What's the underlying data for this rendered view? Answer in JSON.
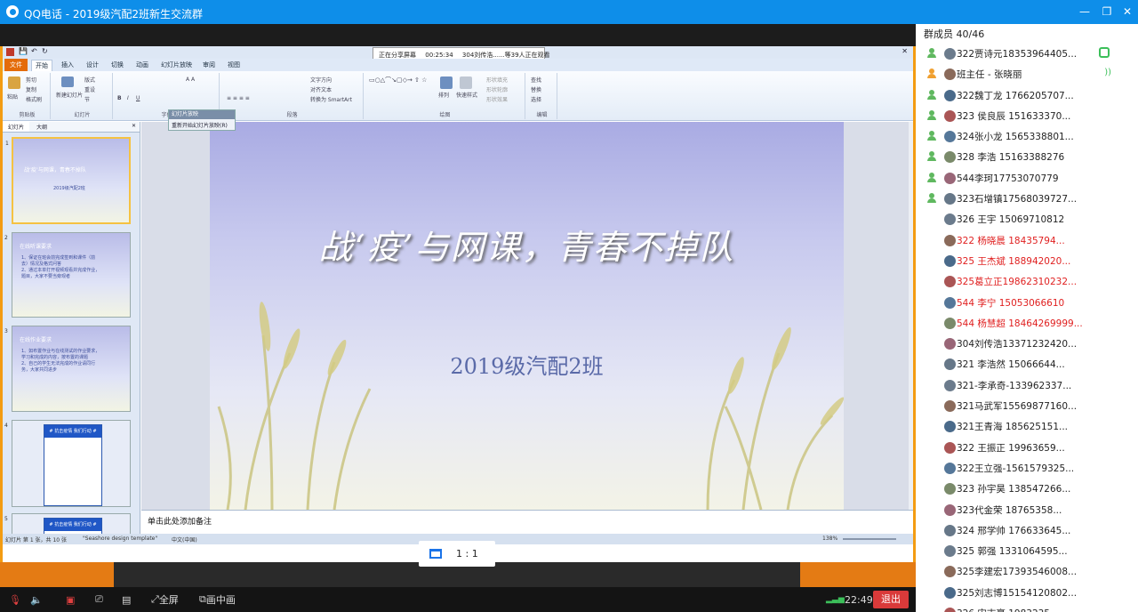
{
  "window": {
    "app_name": "QQ电话",
    "group_title": "2019级汽配2班新生交流群",
    "separator": " - "
  },
  "ppt": {
    "share_status": {
      "label": "正在分享屏幕",
      "time": "00:25:34",
      "viewers": "304刘传浩......等39人正在观看"
    },
    "tabs": [
      "文件",
      "开始",
      "插入",
      "设计",
      "切换",
      "动画",
      "幻灯片放映",
      "审阅",
      "视图"
    ],
    "active_tab": "开始",
    "ribbon": {
      "paste": "粘贴",
      "cut": "剪切",
      "copy": "复制",
      "format_painter": "格式刷",
      "new_slide": "新建幻灯片",
      "layout": "版式",
      "reset": "重设",
      "section": "节",
      "text_direction": "文字方向",
      "align_text": "对齐文本",
      "smartart": "转换为 SmartArt",
      "arrange": "排列",
      "quick_styles": "快速样式",
      "shape_fill": "形状填充",
      "shape_outline": "形状轮廓",
      "shape_effects": "形状效果",
      "find": "查找",
      "replace": "替换",
      "select": "选择",
      "group_clipboard": "剪贴板",
      "group_slides": "幻灯片",
      "group_font": "字体",
      "group_paragraph": "段落",
      "group_drawing": "绘图",
      "group_editing": "编辑"
    },
    "floating_toolbar": {
      "header": "幻灯片放映",
      "item": "重新开始幻灯片放映(R)"
    },
    "pane_tabs": [
      "幻灯片",
      "大纲"
    ],
    "thumbnails": [
      {
        "num": "1",
        "title": "战‘疫’与网课，青春不掉队",
        "sub": "2019级汽配2班"
      },
      {
        "num": "2",
        "title": "在线听课要求",
        "lines": [
          "1、保证在班会前完成签到和课件（前",
          "去）情况及格式问答",
          "2、通过本单打开视频观看并完成作业，",
          "题目，大家不要当旁观者"
        ]
      },
      {
        "num": "3",
        "title": "在线作业要求",
        "lines": [
          "1、如布置作业与在线测试的作业要求，",
          "学习和完成的内容，按布置的课题",
          "2、自己的学生无法完成的作业请同行",
          "务，大家共同进步"
        ]
      },
      {
        "num": "4",
        "title": "# 抗击疫情 我们行动 #"
      },
      {
        "num": "5",
        "title": "# 抗击疫情 我们行动 #"
      }
    ],
    "slide": {
      "title": "战‘疫’与网课，青春不掉队",
      "subtitle": "2019级汽配2班"
    },
    "notes_placeholder": "单击此处添加备注",
    "status": {
      "slide_info": "幻灯片 第 1 张，共 10 张",
      "theme": "\"Seashore design template\"",
      "language": "中文(中国)",
      "zoom": "138%"
    }
  },
  "ratio_label": "1 : 1",
  "bottom": {
    "fullscreen": "全屏",
    "pip": "画中画",
    "time": "22:49",
    "exit": "退出"
  },
  "members": {
    "header": "群成员 40/46",
    "list": [
      {
        "name": "322贾诗元18353964405...",
        "role": "admin",
        "red": false
      },
      {
        "name": "班主任 - 张晓丽",
        "role": "owner",
        "red": false
      },
      {
        "name": "322魏丁龙 1766205707...",
        "role": "admin",
        "red": false
      },
      {
        "name": "323 侯良辰 151633370...",
        "role": "admin",
        "red": false
      },
      {
        "name": "324张小龙 1565338801...",
        "role": "admin",
        "red": false
      },
      {
        "name": "328 李浩 15163388276",
        "role": "admin",
        "red": false
      },
      {
        "name": "544李珂17753070779",
        "role": "admin",
        "red": false
      },
      {
        "name": "323石增镇17568039727...",
        "role": "admin",
        "red": false
      },
      {
        "name": "326 王宇 15069710812",
        "role": "none",
        "red": false
      },
      {
        "name": "322   杨晓晨  18435794...",
        "role": "none",
        "red": true
      },
      {
        "name": "325  王杰斌 188942020...",
        "role": "none",
        "red": true
      },
      {
        "name": "325葛立正19862310232...",
        "role": "none",
        "red": true
      },
      {
        "name": "544 李宁 15053066610",
        "role": "none",
        "red": true
      },
      {
        "name": "544 杨慧超 18464269999...",
        "role": "none",
        "red": true
      },
      {
        "name": "304刘传浩13371232420...",
        "role": "none",
        "red": false
      },
      {
        "name": "321    李浩然  15066644...",
        "role": "none",
        "red": false
      },
      {
        "name": "321-李承奇-133962337...",
        "role": "none",
        "red": false
      },
      {
        "name": "321马武军15569877160...",
        "role": "none",
        "red": false
      },
      {
        "name": "321王青海    185625151...",
        "role": "none",
        "red": false
      },
      {
        "name": "322   王振正  19963659...",
        "role": "none",
        "red": false
      },
      {
        "name": "322王立强-1561579325...",
        "role": "none",
        "red": false
      },
      {
        "name": "323 孙宇昊 138547266...",
        "role": "none",
        "red": false
      },
      {
        "name": "323代金荣       18765358...",
        "role": "none",
        "red": false
      },
      {
        "name": "324 邢学帅  176633645...",
        "role": "none",
        "red": false
      },
      {
        "name": "325    郭强   1331064595...",
        "role": "none",
        "red": false
      },
      {
        "name": "325李建宏17393546008...",
        "role": "none",
        "red": false
      },
      {
        "name": "325刘志博15154120802...",
        "role": "none",
        "red": false
      },
      {
        "name": "326 宋志豪  1983235...",
        "role": "none",
        "red": false
      }
    ]
  }
}
